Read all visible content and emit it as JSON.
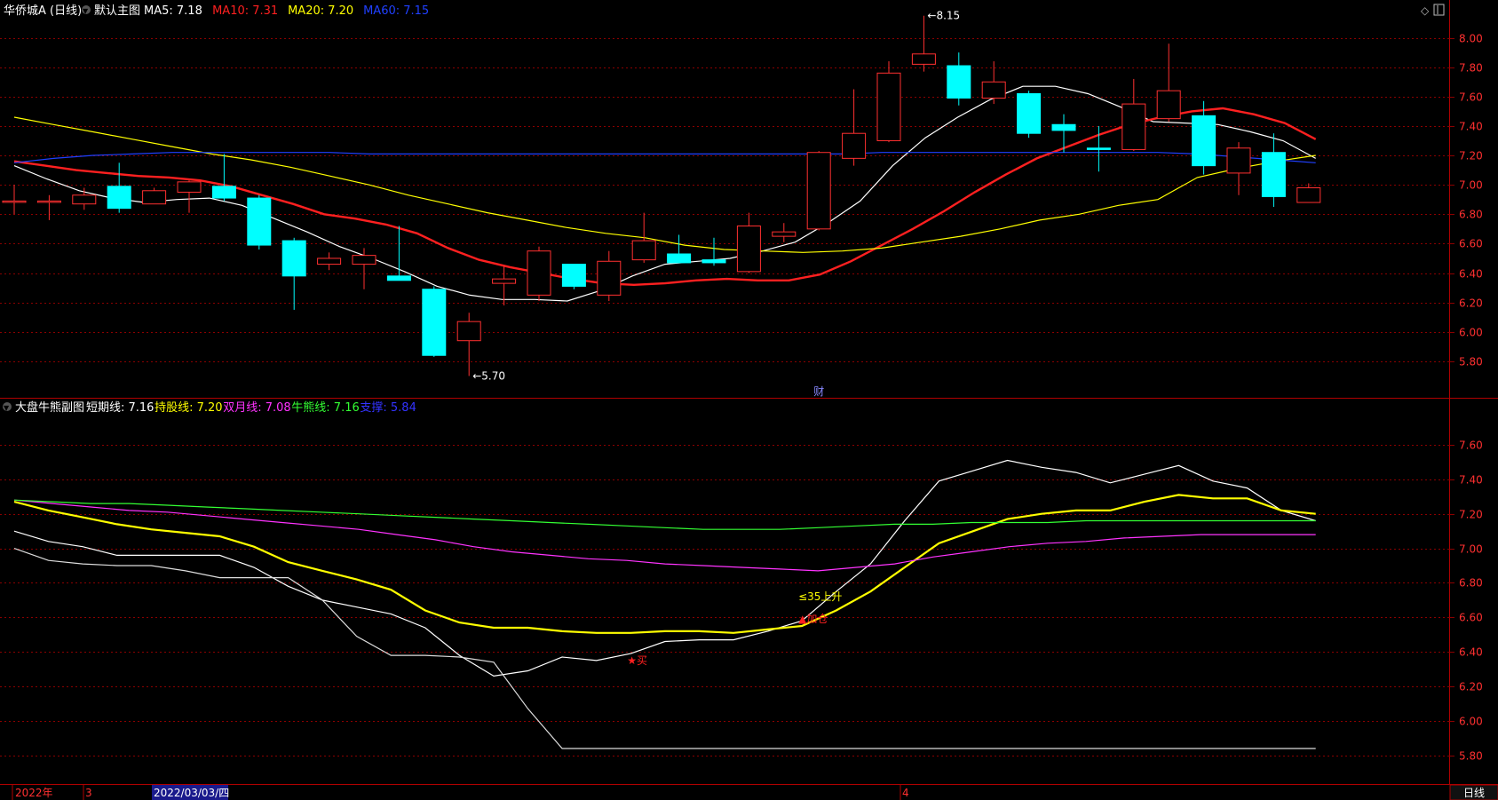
{
  "main_header": {
    "stock": "华侨城A (日线)",
    "chart_name": "默认主图",
    "items": [
      {
        "label": "MA5: 7.18",
        "color": "#ffffff"
      },
      {
        "label": "MA10: 7.31",
        "color": "#ff2020"
      },
      {
        "label": "MA20: 7.20",
        "color": "#ffff00"
      },
      {
        "label": "MA60: 7.15",
        "color": "#2040ff"
      }
    ]
  },
  "sub_header": {
    "chart_name": "大盘牛熊副图",
    "items": [
      {
        "label": "短期线: 7.16",
        "color": "#ffffff"
      },
      {
        "label": "持股线: 7.20",
        "color": "#ffff00"
      },
      {
        "label": "双月线: 7.08",
        "color": "#ff33ff"
      },
      {
        "label": "牛熊线: 7.16",
        "color": "#33ff33"
      },
      {
        "label": "支撑: 5.84",
        "color": "#3333ff"
      }
    ]
  },
  "bottom_bar": {
    "year_label": "2022年",
    "month3_label": "3",
    "date_label": "2022/03/03/四",
    "month4_label": "4",
    "period_label": "日线"
  },
  "colors": {
    "up": "#ff3030",
    "down": "#00ffff",
    "grid": "#8b0000",
    "axis_text": "#ff3030"
  },
  "chart_data": [
    {
      "type": "candlestick",
      "title": "默认主图",
      "ylim": [
        5.6,
        8.1
      ],
      "y_ticks": [
        5.8,
        6.0,
        6.2,
        6.4,
        6.6,
        6.8,
        7.0,
        7.2,
        7.4,
        7.6,
        7.8,
        8.0
      ],
      "candles": [
        {
          "o": 6.89,
          "h": 7.0,
          "l": 6.8,
          "c": 6.89
        },
        {
          "o": 6.89,
          "h": 6.93,
          "l": 6.76,
          "c": 6.89
        },
        {
          "o": 6.87,
          "h": 6.98,
          "l": 6.83,
          "c": 6.93
        },
        {
          "o": 6.99,
          "h": 7.15,
          "l": 6.81,
          "c": 6.84
        },
        {
          "o": 6.87,
          "h": 6.98,
          "l": 6.87,
          "c": 6.96
        },
        {
          "o": 6.95,
          "h": 7.03,
          "l": 6.81,
          "c": 7.02
        },
        {
          "o": 6.99,
          "h": 7.21,
          "l": 6.89,
          "c": 6.91
        },
        {
          "o": 6.91,
          "h": 6.93,
          "l": 6.56,
          "c": 6.59
        },
        {
          "o": 6.62,
          "h": 6.64,
          "l": 6.15,
          "c": 6.38
        },
        {
          "o": 6.46,
          "h": 6.54,
          "l": 6.42,
          "c": 6.5
        },
        {
          "o": 6.46,
          "h": 6.57,
          "l": 6.29,
          "c": 6.52
        },
        {
          "o": 6.38,
          "h": 6.72,
          "l": 6.35,
          "c": 6.35
        },
        {
          "o": 6.29,
          "h": 6.31,
          "l": 5.83,
          "c": 5.84
        },
        {
          "o": 5.94,
          "h": 6.13,
          "l": 5.7,
          "c": 6.07
        },
        {
          "o": 6.33,
          "h": 6.45,
          "l": 6.18,
          "c": 6.36
        },
        {
          "o": 6.25,
          "h": 6.58,
          "l": 6.21,
          "c": 6.55
        },
        {
          "o": 6.46,
          "h": 6.46,
          "l": 6.29,
          "c": 6.31
        },
        {
          "o": 6.25,
          "h": 6.55,
          "l": 6.21,
          "c": 6.48
        },
        {
          "o": 6.49,
          "h": 6.81,
          "l": 6.47,
          "c": 6.62
        },
        {
          "o": 6.53,
          "h": 6.66,
          "l": 6.48,
          "c": 6.47
        },
        {
          "o": 6.49,
          "h": 6.64,
          "l": 6.45,
          "c": 6.47
        },
        {
          "o": 6.41,
          "h": 6.81,
          "l": 6.4,
          "c": 6.72
        },
        {
          "o": 6.65,
          "h": 6.74,
          "l": 6.61,
          "c": 6.68
        },
        {
          "o": 6.7,
          "h": 7.23,
          "l": 6.69,
          "c": 7.22
        },
        {
          "o": 7.18,
          "h": 7.65,
          "l": 7.13,
          "c": 7.35
        },
        {
          "o": 7.3,
          "h": 7.84,
          "l": 7.29,
          "c": 7.76
        },
        {
          "o": 7.82,
          "h": 8.15,
          "l": 7.77,
          "c": 7.89
        },
        {
          "o": 7.81,
          "h": 7.9,
          "l": 7.54,
          "c": 7.59
        },
        {
          "o": 7.59,
          "h": 7.84,
          "l": 7.55,
          "c": 7.7
        },
        {
          "o": 7.62,
          "h": 7.64,
          "l": 7.32,
          "c": 7.35
        },
        {
          "o": 7.41,
          "h": 7.48,
          "l": 7.22,
          "c": 7.37
        },
        {
          "o": 7.25,
          "h": 7.4,
          "l": 7.09,
          "c": 7.24
        },
        {
          "o": 7.24,
          "h": 7.72,
          "l": 7.23,
          "c": 7.55
        },
        {
          "o": 7.45,
          "h": 7.96,
          "l": 7.43,
          "c": 7.64
        },
        {
          "o": 7.47,
          "h": 7.57,
          "l": 7.07,
          "c": 7.13
        },
        {
          "o": 7.08,
          "h": 7.29,
          "l": 6.93,
          "c": 7.25
        },
        {
          "o": 7.22,
          "h": 7.35,
          "l": 6.85,
          "c": 6.92
        },
        {
          "o": 6.88,
          "h": 7.01,
          "l": 6.88,
          "c": 6.98
        }
      ],
      "series": [
        {
          "name": "MA5",
          "color": "#ffffff",
          "start": 0,
          "values": [
            7.13,
            7.04,
            6.96,
            6.91,
            6.88,
            6.9,
            6.91,
            6.86,
            6.77,
            6.68,
            6.58,
            6.5,
            6.41,
            6.31,
            6.25,
            6.22,
            6.22,
            6.21,
            6.28,
            6.38,
            6.46,
            6.48,
            6.5,
            6.55,
            6.61,
            6.74,
            6.89,
            7.13,
            7.32,
            7.46,
            7.58,
            7.67,
            7.67,
            7.62,
            7.53,
            7.43,
            7.42,
            7.41,
            7.36,
            7.3,
            7.18
          ]
        },
        {
          "name": "MA10",
          "color": "#ff2020",
          "start": 0,
          "values": [
            7.16,
            7.13,
            7.1,
            7.08,
            7.06,
            7.05,
            7.03,
            6.99,
            6.93,
            6.87,
            6.8,
            6.77,
            6.73,
            6.67,
            6.57,
            6.49,
            6.44,
            6.4,
            6.36,
            6.33,
            6.32,
            6.33,
            6.35,
            6.36,
            6.35,
            6.35,
            6.39,
            6.48,
            6.59,
            6.7,
            6.82,
            6.95,
            7.07,
            7.18,
            7.26,
            7.34,
            7.41,
            7.46,
            7.5,
            7.52,
            7.48,
            7.42,
            7.31
          ]
        },
        {
          "name": "MA20",
          "color": "#ffff00",
          "start": 0,
          "values": [
            7.46,
            7.41,
            7.36,
            7.31,
            7.26,
            7.21,
            7.17,
            7.12,
            7.06,
            7.0,
            6.93,
            6.87,
            6.81,
            6.76,
            6.71,
            6.67,
            6.64,
            6.59,
            6.56,
            6.55,
            6.54,
            6.55,
            6.57,
            6.61,
            6.65,
            6.7,
            6.76,
            6.8,
            6.86,
            6.9,
            7.05,
            7.11,
            7.16,
            7.2
          ]
        },
        {
          "name": "MA60",
          "color": "#2040ff",
          "start": 0,
          "values": [
            7.15,
            7.18,
            7.2,
            7.21,
            7.22,
            7.22,
            7.22,
            7.22,
            7.22,
            7.21,
            7.21,
            7.21,
            7.21,
            7.21,
            7.21,
            7.21,
            7.21,
            7.21,
            7.21,
            7.21,
            7.21,
            7.21,
            7.22,
            7.22,
            7.22,
            7.22,
            7.22,
            7.22,
            7.22,
            7.22,
            7.21,
            7.19,
            7.17,
            7.15
          ]
        }
      ],
      "annotations": [
        {
          "text": "8.15",
          "candle": 26,
          "value": 8.15
        },
        {
          "text": "5.70",
          "candle": 13,
          "value": 5.7
        },
        {
          "text": "财",
          "candle": 23
        }
      ]
    },
    {
      "type": "line",
      "title": "大盘牛熊副图",
      "ylim": [
        5.67,
        7.77
      ],
      "y_ticks": [
        5.8,
        6.0,
        6.2,
        6.4,
        6.6,
        6.8,
        7.0,
        7.2,
        7.4,
        7.6
      ],
      "series": [
        {
          "name": "短期线",
          "color": "#ffffff",
          "values": [
            7.1,
            7.04,
            7.01,
            6.96,
            6.96,
            6.96,
            6.96,
            6.89,
            6.78,
            6.7,
            6.66,
            6.62,
            6.54,
            6.38,
            6.26,
            6.29,
            6.37,
            6.35,
            6.39,
            6.46,
            6.47,
            6.47,
            6.52,
            6.58,
            6.75,
            6.91,
            7.16,
            7.39,
            7.45,
            7.51,
            7.47,
            7.44,
            7.38,
            7.43,
            7.48,
            7.39,
            7.35,
            7.22,
            7.16
          ]
        },
        {
          "name": "持股线",
          "color": "#ffff00",
          "values": [
            7.27,
            7.22,
            7.18,
            7.14,
            7.11,
            7.09,
            7.07,
            7.01,
            6.92,
            6.87,
            6.82,
            6.76,
            6.64,
            6.57,
            6.54,
            6.54,
            6.52,
            6.51,
            6.51,
            6.52,
            6.52,
            6.51,
            6.53,
            6.55,
            6.64,
            6.75,
            6.89,
            7.03,
            7.1,
            7.17,
            7.2,
            7.22,
            7.22,
            7.27,
            7.31,
            7.29,
            7.29,
            7.22,
            7.2
          ]
        },
        {
          "name": "双月线",
          "color": "#ff33ff",
          "values": [
            7.28,
            7.26,
            7.24,
            7.22,
            7.21,
            7.19,
            7.17,
            7.15,
            7.13,
            7.11,
            7.08,
            7.05,
            7.01,
            6.98,
            6.96,
            6.94,
            6.93,
            6.91,
            6.9,
            6.89,
            6.88,
            6.87,
            6.89,
            6.91,
            6.95,
            6.98,
            7.01,
            7.03,
            7.04,
            7.06,
            7.07,
            7.08,
            7.08,
            7.08,
            7.08
          ]
        },
        {
          "name": "牛熊线",
          "color": "#33ff33",
          "values": [
            7.28,
            7.27,
            7.26,
            7.26,
            7.25,
            7.24,
            7.23,
            7.22,
            7.21,
            7.2,
            7.19,
            7.18,
            7.17,
            7.16,
            7.15,
            7.14,
            7.13,
            7.12,
            7.11,
            7.11,
            7.11,
            7.12,
            7.13,
            7.14,
            7.14,
            7.15,
            7.15,
            7.15,
            7.16,
            7.16,
            7.16,
            7.16,
            7.16,
            7.16,
            7.16
          ]
        },
        {
          "name": "支撑",
          "color": "#dddddd",
          "values": [
            7.0,
            6.93,
            6.91,
            6.9,
            6.9,
            6.87,
            6.83,
            6.83,
            6.83,
            6.7,
            6.49,
            6.38,
            6.38,
            6.37,
            6.34,
            6.07,
            5.84,
            5.84,
            5.84,
            5.84,
            5.84,
            5.84,
            5.84,
            5.84,
            5.84,
            5.84,
            5.84,
            5.84,
            5.84,
            5.84,
            5.84,
            5.84,
            5.84,
            5.84,
            5.84,
            5.84,
            5.84,
            5.84,
            5.84
          ]
        }
      ],
      "annotations": [
        {
          "text": "≤35上升",
          "color": "#ffff00",
          "index": 23,
          "value": 6.7
        },
        {
          "text": "▲加仓",
          "color": "#ff2020",
          "index": 23,
          "value": 6.57
        },
        {
          "text": "★买",
          "color": "#ff2020",
          "index": 18,
          "value": 6.33
        }
      ]
    }
  ]
}
